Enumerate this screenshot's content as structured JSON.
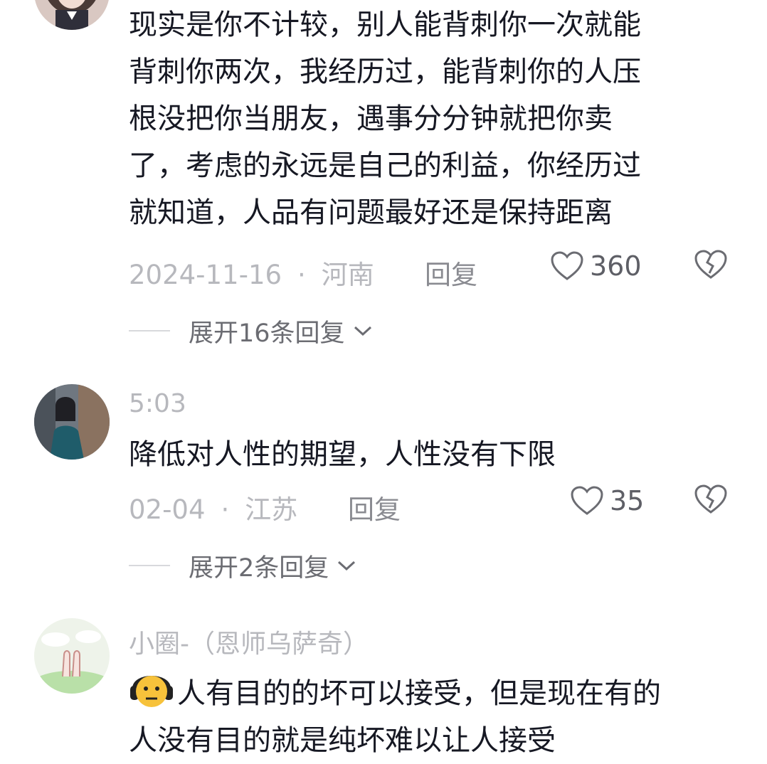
{
  "comments": [
    {
      "username": "",
      "text": "现实是你不计较，别人能背刺你一次就能\n背刺你两次，我经历过，能背刺你的人压\n根没把你当朋友，遇事分分钟就把你卖\n了，考虑的永远是自己的利益，你经历过\n就知道，人品有问题最好还是保持距离",
      "date": "2024-11-16",
      "location": "河南",
      "reply_label": "回复",
      "likes": "360",
      "expand_label": "展开16条回复"
    },
    {
      "username": "5:03",
      "text": "降低对人性的期望，人性没有下限",
      "date": "02-04",
      "location": "江苏",
      "reply_label": "回复",
      "likes": "35",
      "expand_label": "展开2条回复"
    },
    {
      "username": "小圈-（恩师乌萨奇）",
      "emoji": "headphone-face-emoji",
      "text": "人有目的的坏可以接受，但是现在有的\n人没有目的就是纯坏难以让人接受"
    }
  ],
  "separator_dot": "·",
  "colors": {
    "text": "#161823",
    "meta": "#b7b8bd",
    "reply": "#8a8b91"
  }
}
